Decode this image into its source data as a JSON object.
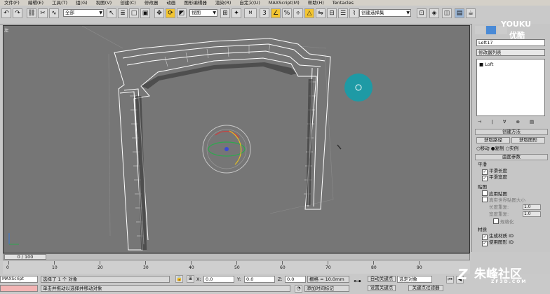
{
  "menu": [
    "文件(F)",
    "编辑(E)",
    "工具(T)",
    "组(G)",
    "视图(V)",
    "创建(C)",
    "修改器",
    "动画",
    "图形编辑器",
    "渲染(R)",
    "自定义(U)",
    "MAXScript(M)",
    "帮助(H)",
    "Tentacles"
  ],
  "toolbar": {
    "filter_select": "全部",
    "refcoord_select": "视图",
    "named_selection": "创建选择集"
  },
  "viewport": {
    "label": "左"
  },
  "command_panel": {
    "object_name": "Left17",
    "modifier_list": "修改器列表",
    "stack_item": "■ Loft",
    "rollouts": {
      "creation_method": "创建方法",
      "surface_params": "曲面参数",
      "smoothing_group": "平滑",
      "mapping_group": "贴图",
      "material_group": "材质"
    },
    "buttons": {
      "get_path": "获取路径",
      "get_shape": "获取图形"
    },
    "radios": {
      "move": "移动",
      "copy": "复制",
      "instance": "实例"
    },
    "checks": {
      "smooth_length": "平滑长度",
      "smooth_width": "平滑宽度",
      "apply_mapping": "应用贴图",
      "real_world": "真实世界贴图大小",
      "gen_mat_ids": "生成材质 ID",
      "use_shape_ids": "使用图形 ID"
    },
    "labels": {
      "length_repeat": "长度重复:",
      "width_repeat": "宽度重复:",
      "normalize": "规格化"
    },
    "values": {
      "length_repeat": "1.0",
      "width_repeat": "1.0"
    }
  },
  "timeline": {
    "frame_counter": "0 / 100",
    "ticks": [
      "0",
      "10",
      "20",
      "30",
      "40",
      "50",
      "60",
      "70",
      "80",
      "90"
    ]
  },
  "status": {
    "selected": "选择了 1 个 对象",
    "prompt": "单击并拖动以选择并移动对象",
    "x": "0.0",
    "y": "0.0",
    "z": "0.0",
    "grid": "栅格 = 10.0mm",
    "auto_key": "自动关键点",
    "set_key": "设置关键点",
    "key_filter_select": "选定对象",
    "key_filters": "关键点过滤器",
    "add_time_tag": "添加时间标记",
    "script_listener": "MAXScript"
  },
  "watermarks": {
    "youku": "YOUKU",
    "youku_cn": "优酷",
    "zf3d": "朱峰社区",
    "zf3d_url": "ZF3D.COM"
  },
  "colors": {
    "viewport_bg": "#767676",
    "wire": "#ffffff",
    "gizmo_teal": "#1e9aa5",
    "toolbar": "#c9c9c9"
  }
}
